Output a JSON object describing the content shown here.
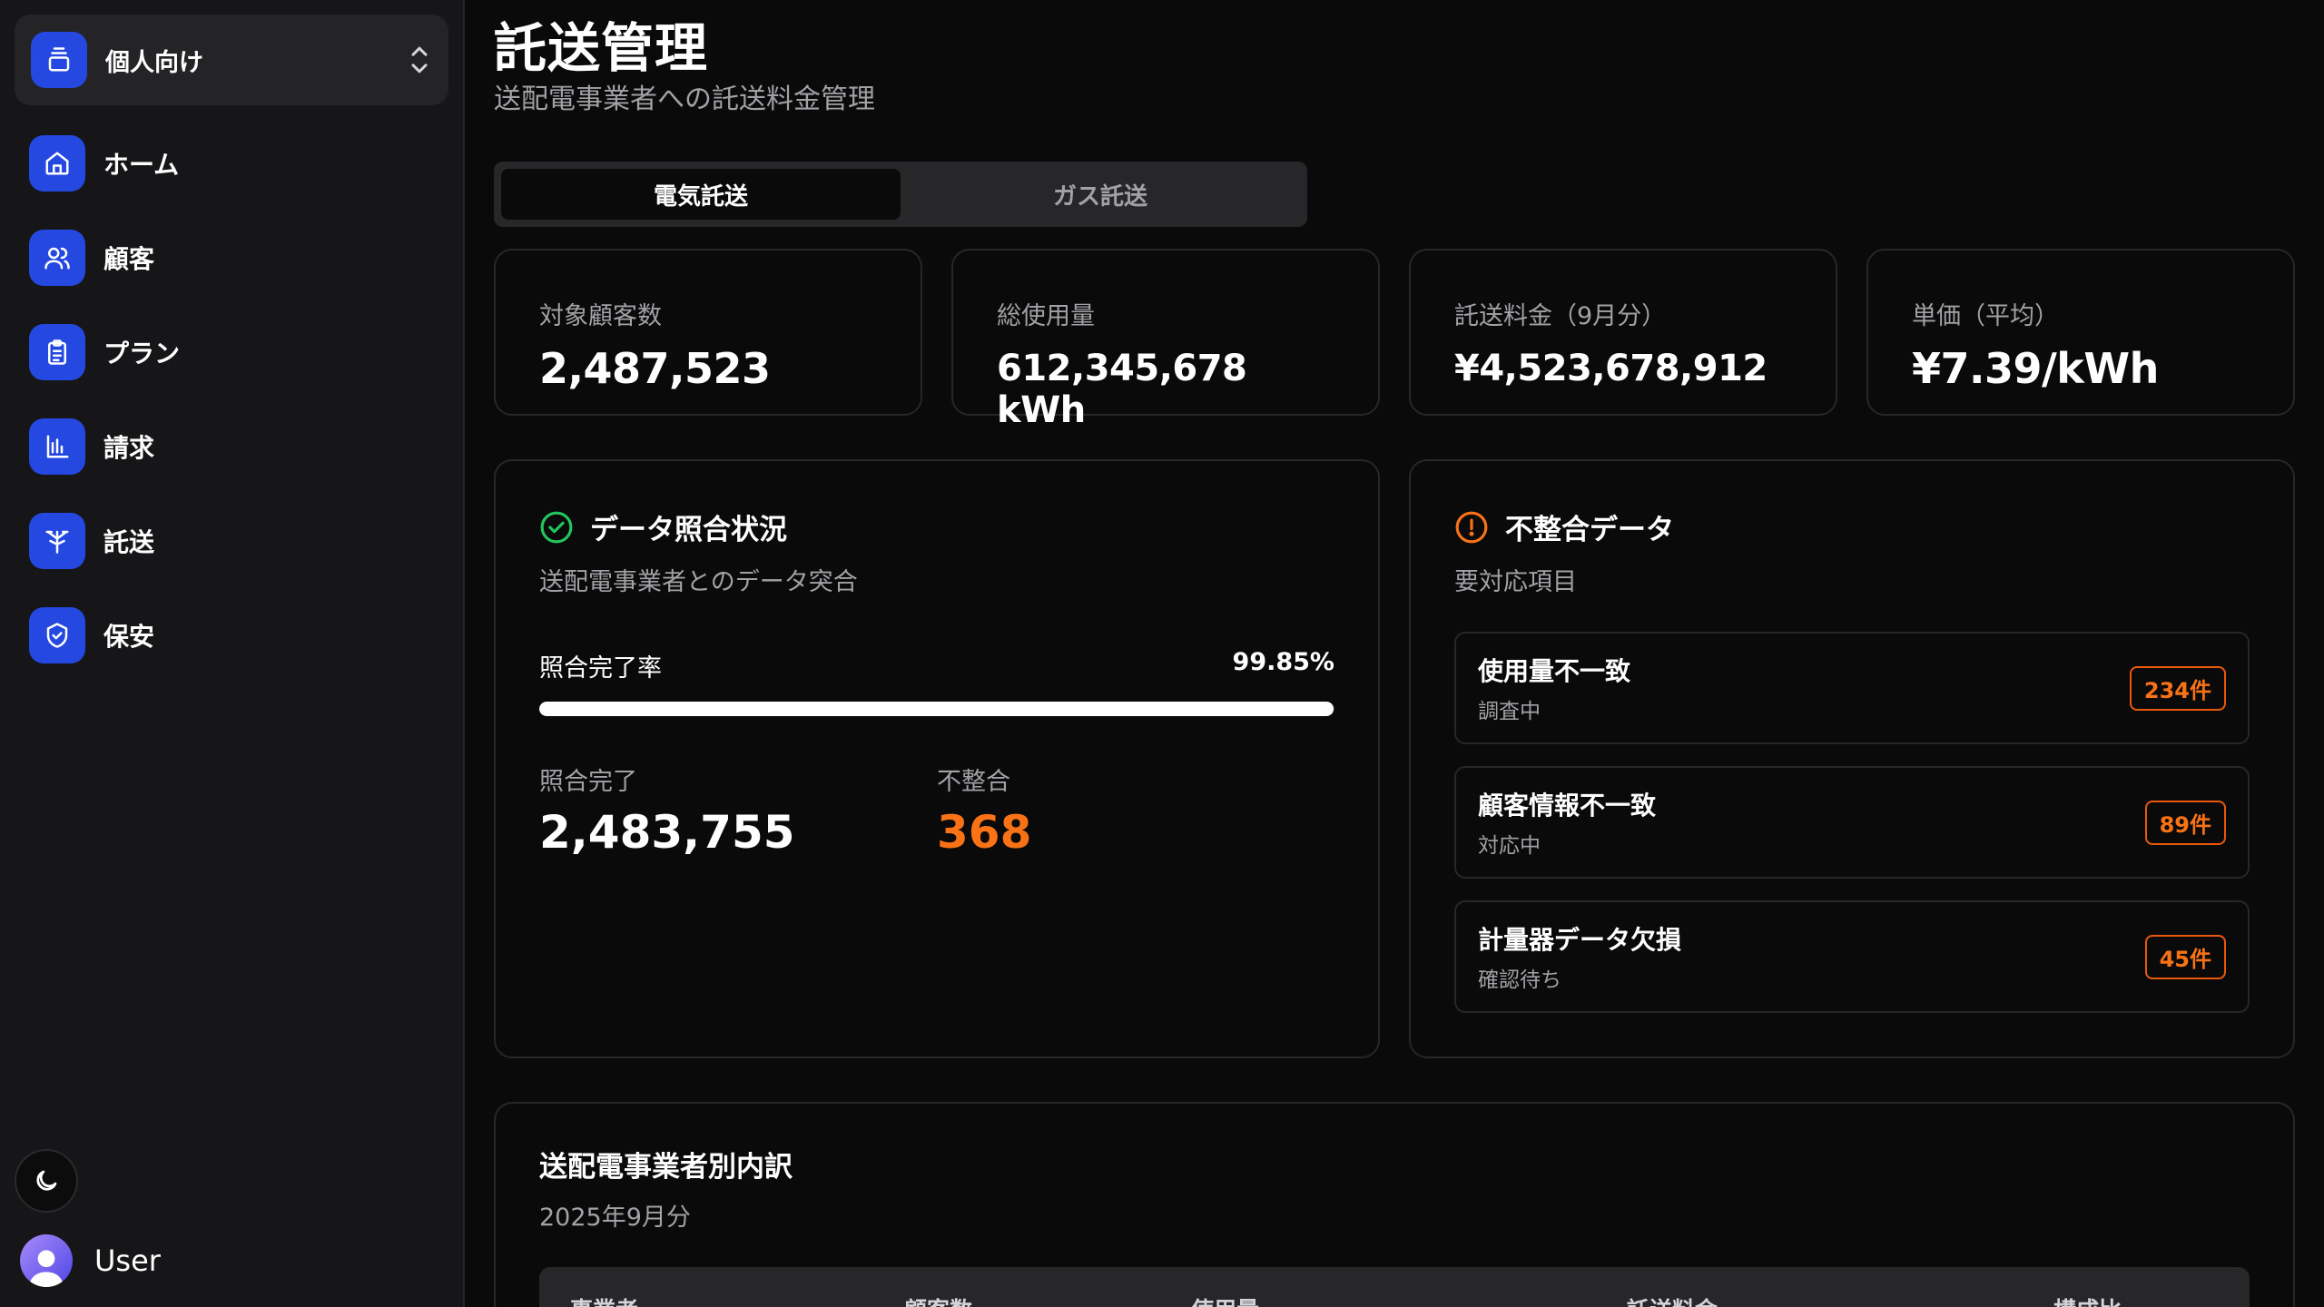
{
  "sidebar": {
    "workspace_label": "個人向け",
    "items": [
      {
        "label": "ホーム",
        "icon": "home-icon"
      },
      {
        "label": "顧客",
        "icon": "users-icon"
      },
      {
        "label": "プラン",
        "icon": "clipboard-icon"
      },
      {
        "label": "請求",
        "icon": "chart-icon"
      },
      {
        "label": "託送",
        "icon": "transmission-tower-icon"
      },
      {
        "label": "保安",
        "icon": "shield-check-icon"
      }
    ],
    "user_name": "User"
  },
  "header": {
    "title": "託送管理",
    "subtitle": "送配電事業者への託送料金管理"
  },
  "tabs": [
    {
      "label": "電気託送",
      "active": true
    },
    {
      "label": "ガス託送",
      "active": false
    }
  ],
  "stats": [
    {
      "label": "対象顧客数",
      "value": "2,487,523"
    },
    {
      "label": "総使用量",
      "value": "612,345,678 kWh"
    },
    {
      "label": "託送料金（9月分）",
      "value": "¥4,523,678,912"
    },
    {
      "label": "単価（平均）",
      "value": "¥7.39/kWh"
    }
  ],
  "reconciliation": {
    "title": "データ照合状況",
    "subtitle": "送配電事業者とのデータ突合",
    "rate_label": "照合完了率",
    "rate_value": "99.85%",
    "rate_fraction": 0.9985,
    "completed_label": "照合完了",
    "completed_value": "2,483,755",
    "mismatch_label": "不整合",
    "mismatch_value": "368"
  },
  "inconsistency": {
    "title": "不整合データ",
    "subtitle": "要対応項目",
    "items": [
      {
        "title": "使用量不一致",
        "status": "調査中",
        "count": "234件"
      },
      {
        "title": "顧客情報不一致",
        "status": "対応中",
        "count": "89件"
      },
      {
        "title": "計量器データ欠損",
        "status": "確認待ち",
        "count": "45件"
      }
    ]
  },
  "breakdown": {
    "title": "送配電事業者別内訳",
    "subtitle": "2025年9月分",
    "columns": [
      "事業者",
      "顧客数",
      "使用量",
      "託送料金",
      "構成比"
    ]
  },
  "colors": {
    "accent": "#2549e0",
    "warning": "#f97316",
    "success": "#22c55e",
    "background": "#0a0a0a",
    "sidebar": "#161618"
  }
}
